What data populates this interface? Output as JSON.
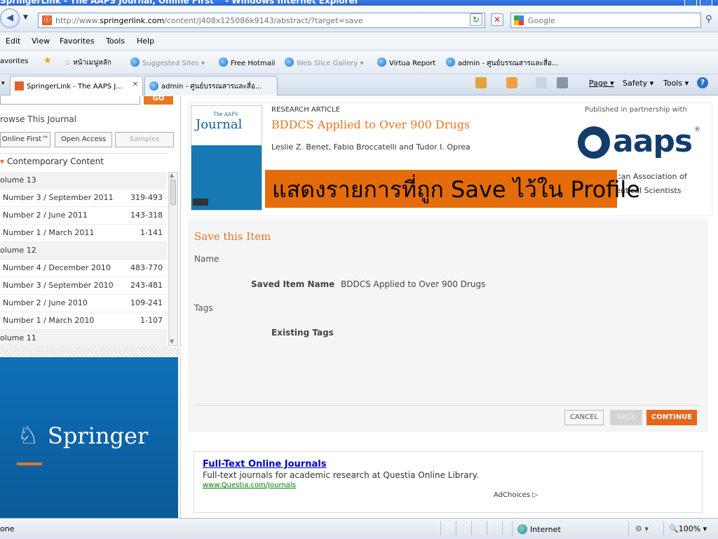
{
  "window": {
    "title": "SpringerLink - The AAPS Journal, Online First™ - Windows Internet Explorer"
  },
  "address": {
    "url_prefix": "http://www.",
    "url_domain": "springerlink.com",
    "url_path": "/content/j408x125086k9143/abstract/?target=save"
  },
  "search": {
    "placeholder": "Google"
  },
  "menu": [
    "Edit",
    "View",
    "Favorites",
    "Tools",
    "Help"
  ],
  "favorites": {
    "label": "avorites",
    "items": [
      "หน้าเมนูหลัก",
      "Suggested Sites ▾",
      "Free Hotmail",
      "Web Slice Gallery ▾",
      "Virtua Report",
      "admin - ศูนย์บรรณสารและสื่อ..."
    ]
  },
  "tabs": [
    "SpringerLink - The AAPS J...",
    "admin - ศูนย์บรรณสารและสื่อ..."
  ],
  "commands": [
    "Page ▾",
    "Safety ▾",
    "Tools ▾"
  ],
  "left": {
    "go_label": "GO",
    "browse_title": "rowse This Journal",
    "chips": [
      "Online First™",
      "Open Access",
      "Samples"
    ],
    "contemporary": "Contemporary Content",
    "volumes": [
      {
        "label": "olume 13",
        "pages": "",
        "kind": "vol"
      },
      {
        "label": "Number 3 / September 2011",
        "pages": "319-493",
        "kind": "num"
      },
      {
        "label": "Number 2 / June 2011",
        "pages": "143-318",
        "kind": "num"
      },
      {
        "label": "Number 1 / March 2011",
        "pages": "1-141",
        "kind": "num"
      },
      {
        "label": "olume 12",
        "pages": "",
        "kind": "vol"
      },
      {
        "label": "Number 4 / December 2010",
        "pages": "483-770",
        "kind": "num"
      },
      {
        "label": "Number 3 / September 2010",
        "pages": "243-481",
        "kind": "num"
      },
      {
        "label": "Number 2 / June 2010",
        "pages": "109-241",
        "kind": "num"
      },
      {
        "label": "Number 1 / March 2010",
        "pages": "1-107",
        "kind": "num"
      },
      {
        "label": "olume 11",
        "pages": "",
        "kind": "vol"
      }
    ],
    "springer_logo": "Springer"
  },
  "article": {
    "type": "RESEARCH ARTICLE",
    "title": "BDDCS Applied to Over 900 Drugs",
    "authors": "Leslie Z. Benet, Fabio Broccatelli and Tudor I. Oprea",
    "cover_journal": "The AAPS",
    "cover_journal_big": "Journal",
    "partner_text": "Published in partnership with",
    "aaps_logo": "aaps",
    "aaps_reg": "®",
    "aaps_sub1": "rican Association of",
    "aaps_sub2": "ceutical Scientists"
  },
  "overlay": {
    "text": "แสดงรายการที่ถูก Save ไว้ใน Profile"
  },
  "form": {
    "title": "Save this Item",
    "name_label": "Name",
    "saved_item_label": "Saved Item Name",
    "saved_item_value": "BDDCS Applied to Over 900 Drugs",
    "tags_label": "Tags",
    "existing_tags_label": "Existing Tags",
    "cancel": "CANCEL",
    "back": "BACK",
    "continue": "CONTINUE"
  },
  "ad": {
    "title": "Full-Text Online Journals",
    "desc": "Full-text journals for academic research at Questia Online Library.",
    "url": "www.Questia.com/Journals",
    "choices": "AdChoices ▷"
  },
  "status": {
    "left": "one",
    "zone": "Internet",
    "zoom": "100%"
  },
  "colors": {
    "accent": "#e87722",
    "springer_blue": "#0f6fb8",
    "overlay": "#e46c0a"
  }
}
